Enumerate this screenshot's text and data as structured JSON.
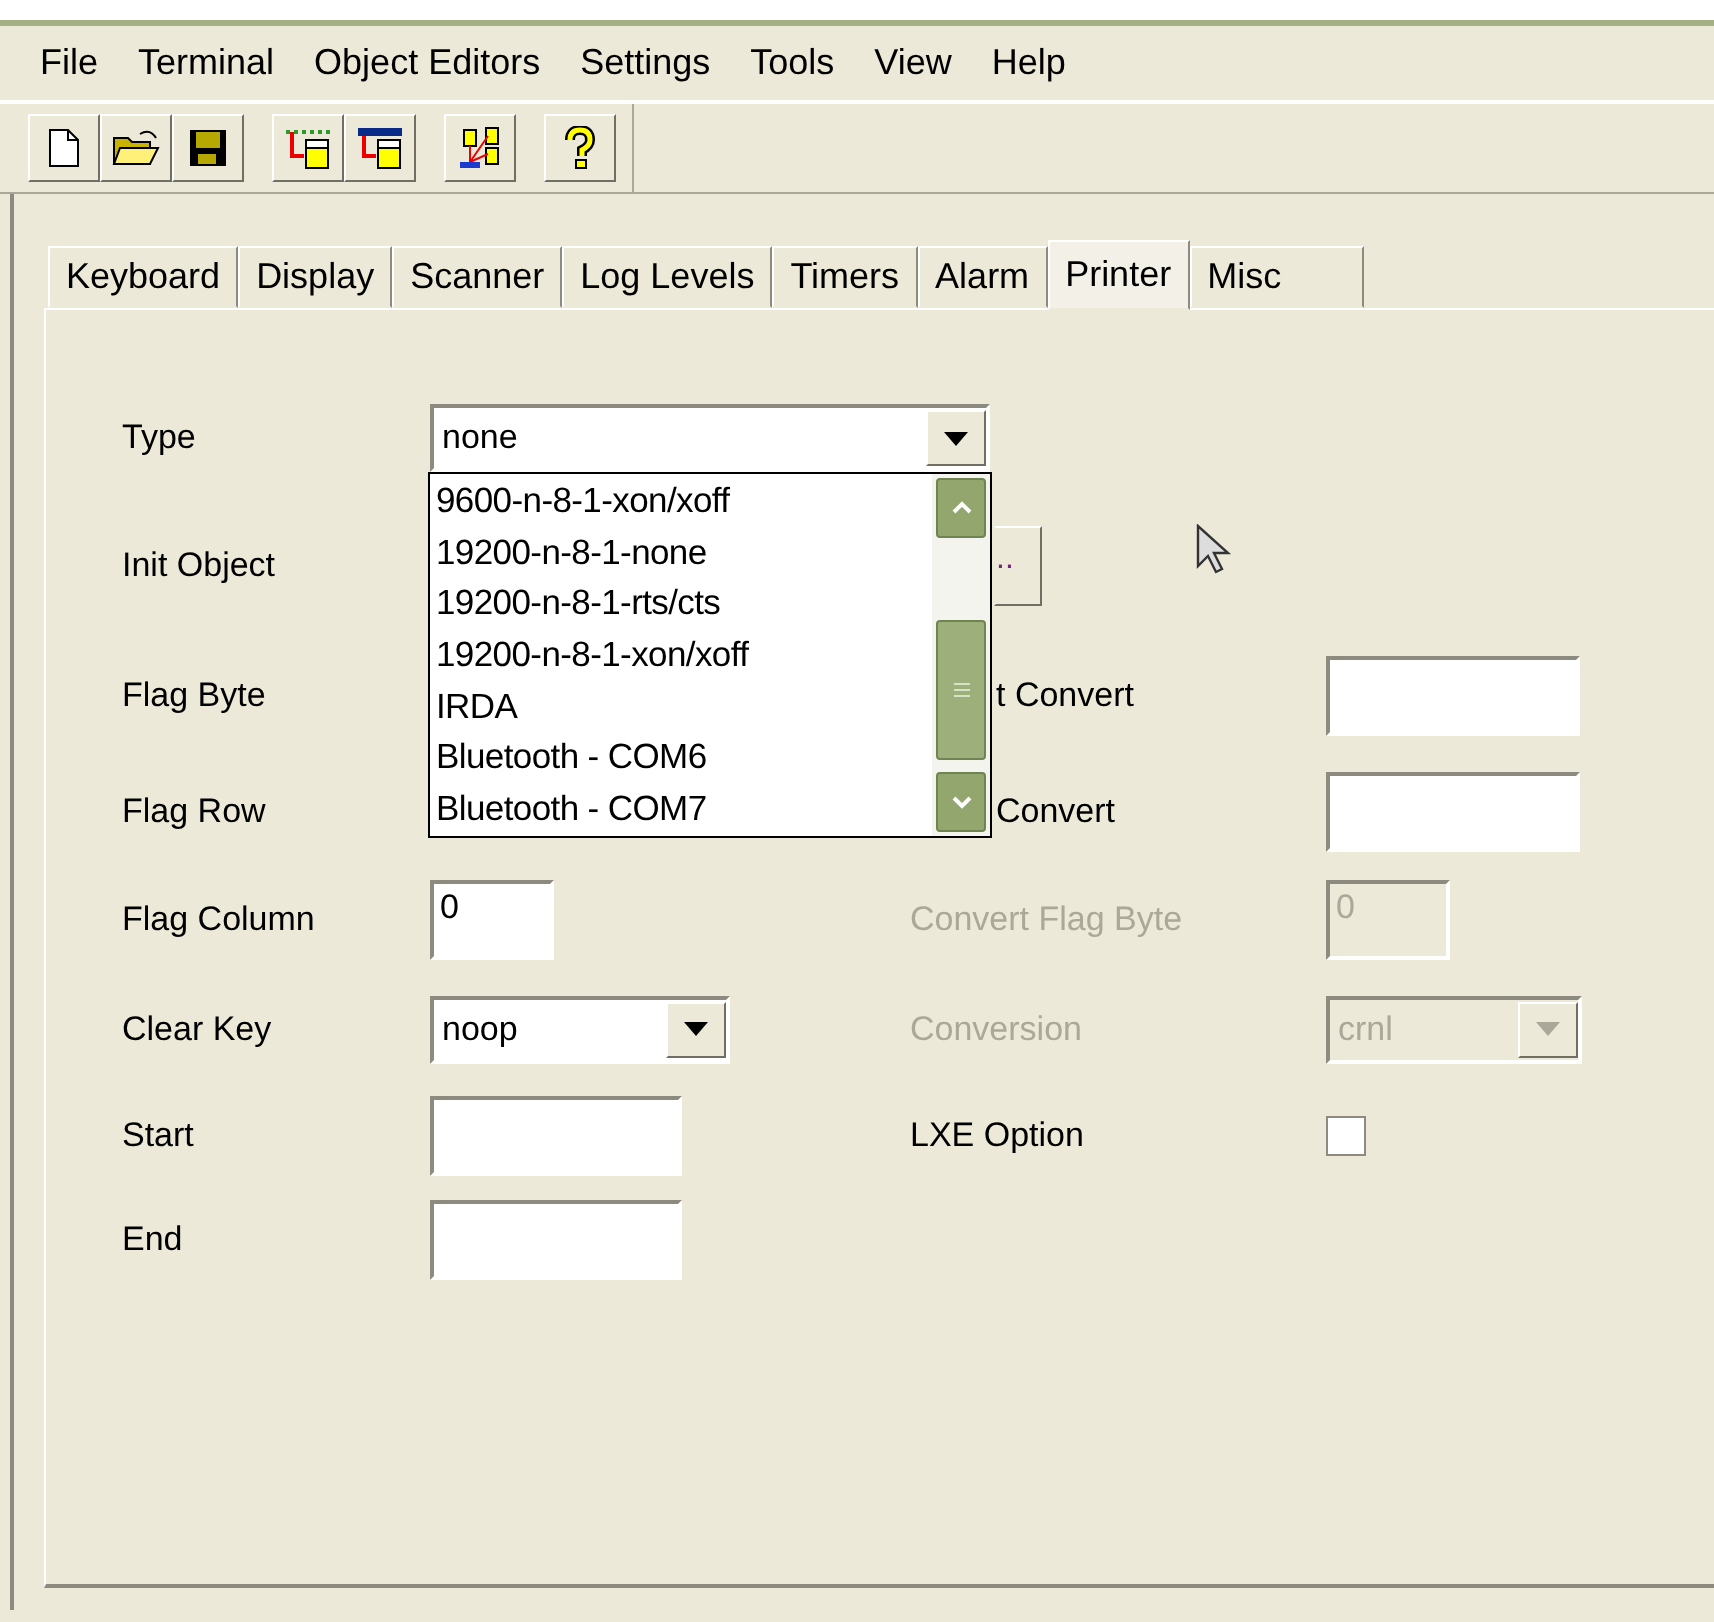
{
  "menu": [
    "File",
    "Terminal",
    "Object Editors",
    "Settings",
    "Tools",
    "View",
    "Help"
  ],
  "tabs": [
    {
      "label": "Keyboard",
      "selected": false
    },
    {
      "label": "Display",
      "selected": false
    },
    {
      "label": "Scanner",
      "selected": false
    },
    {
      "label": "Log Levels",
      "selected": false
    },
    {
      "label": "Timers",
      "selected": false
    },
    {
      "label": "Alarm",
      "selected": false
    },
    {
      "label": "Printer",
      "selected": true
    },
    {
      "label": "Misc",
      "selected": false
    }
  ],
  "left": [
    {
      "label": "Type",
      "kind": "combo",
      "value": "none"
    },
    {
      "label": "Init Object",
      "kind": "button",
      "value": ".."
    },
    {
      "label": "Flag Byte",
      "kind": "covered"
    },
    {
      "label": "Flag Row",
      "kind": "covered"
    },
    {
      "label": "Flag Column",
      "kind": "text",
      "value": "0"
    },
    {
      "label": "Clear Key",
      "kind": "combo",
      "value": "noop"
    },
    {
      "label": "Start",
      "kind": "text"
    },
    {
      "label": "End",
      "kind": "text"
    }
  ],
  "right": [
    {
      "label": "t Convert",
      "kind": "text",
      "disabled": false
    },
    {
      "label": "Convert",
      "kind": "text",
      "disabled": false
    },
    {
      "label": "Convert Flag Byte",
      "kind": "text",
      "value": "0",
      "disabled": true
    },
    {
      "label": "Conversion",
      "kind": "combo",
      "value": "crnl",
      "disabled": true
    },
    {
      "label": "LXE Option",
      "kind": "checkbox",
      "checked": false,
      "disabled": false
    }
  ],
  "type_list": [
    {
      "label": "9600-n-8-1-xon/xoff",
      "selected": false
    },
    {
      "label": "19200-n-8-1-none",
      "selected": false
    },
    {
      "label": "19200-n-8-1-rts/cts",
      "selected": false
    },
    {
      "label": "19200-n-8-1-xon/xoff",
      "selected": false
    },
    {
      "label": "IRDA",
      "selected": false
    },
    {
      "label": "Bluetooth - COM6",
      "selected": false
    },
    {
      "label": "Bluetooth - COM7",
      "selected": false
    }
  ]
}
